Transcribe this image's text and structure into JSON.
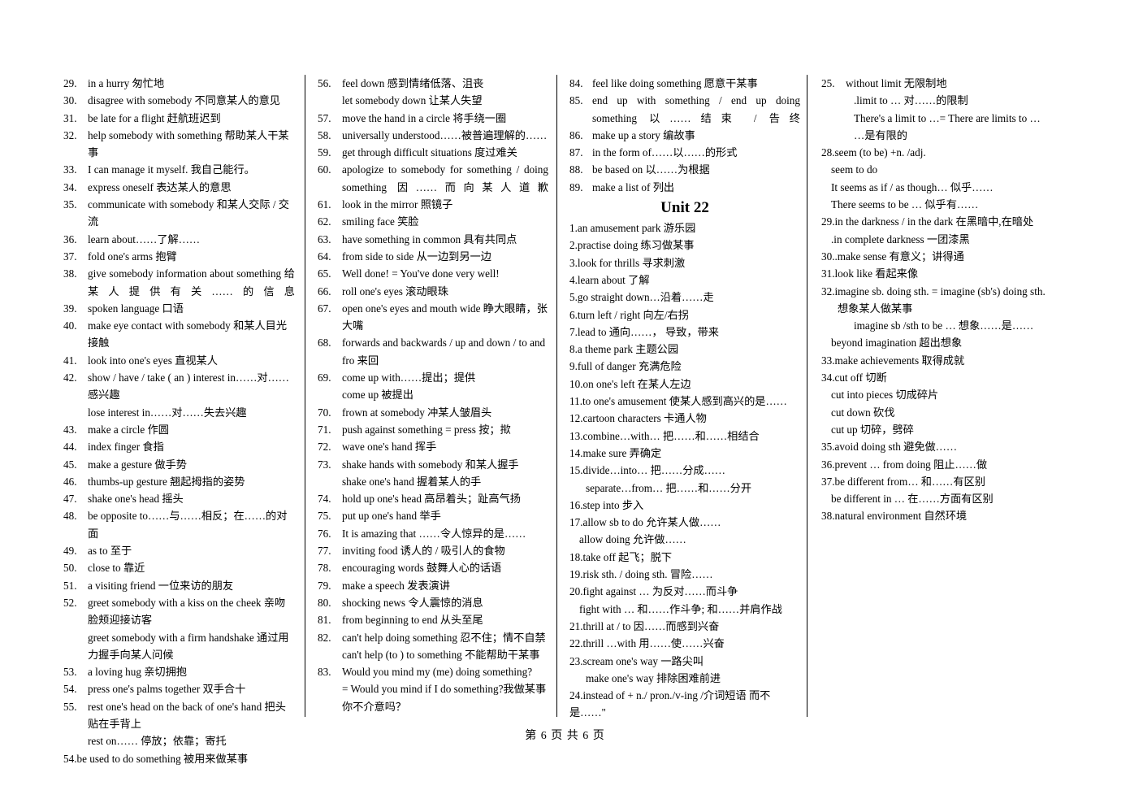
{
  "document": {
    "footer": "第 6 页 共 6 页",
    "unit_heading": "Unit 22"
  },
  "columns": [
    {
      "id": "column-1",
      "entries": [
        {
          "num": "29.",
          "text": "in a hurry  匆忙地"
        },
        {
          "num": "30.",
          "text": "disagree with somebody  不同意某人的意见"
        },
        {
          "num": "31.",
          "text": "be late for a flight  赶航班迟到"
        },
        {
          "num": "32.",
          "text": "help somebody with something  帮助某人干某事"
        },
        {
          "num": "33.",
          "text": "I can manage it myself. 我自己能行。"
        },
        {
          "num": "34.",
          "text": "express oneself  表达某人的意思"
        },
        {
          "num": "35.",
          "text": "communicate with somebody  和某人交际 / 交流"
        },
        {
          "num": "36.",
          "text": "learn about……了解……"
        },
        {
          "num": "37.",
          "text": "fold one's arms  抱臂"
        },
        {
          "num": "38.",
          "text": "give somebody information about something  给某人提供有关……的信息"
        },
        {
          "num": "39.",
          "text": "spoken language  口语"
        },
        {
          "num": "40.",
          "text": "make eye contact with somebody  和某人目光接触"
        },
        {
          "num": "41.",
          "text": "look into one's eyes  直视某人"
        },
        {
          "num": "42.",
          "text": "show / have / take ( an ) interest in……对……感兴趣"
        },
        {
          "num": "",
          "text": "lose interest in……对……失去兴趣",
          "sub": true
        },
        {
          "num": "43.",
          "text": "make a circle  作圆"
        },
        {
          "num": "44.",
          "text": "index finger  食指"
        },
        {
          "num": "45.",
          "text": "make a gesture  做手势"
        },
        {
          "num": "46.",
          "text": "thumbs-up gesture  翘起拇指的姿势"
        },
        {
          "num": "47.",
          "text": "shake one's head  摇头"
        },
        {
          "num": "48.",
          "text": "be opposite to……与……相反；在……的对面"
        },
        {
          "num": "49.",
          "text": "as to  至于"
        },
        {
          "num": "50.",
          "text": "close to  靠近"
        },
        {
          "num": "51.",
          "text": "a visiting friend  一位来访的朋友"
        },
        {
          "num": "52.",
          "text": "greet somebody with a kiss on the cheek  亲吻脸颊迎接访客"
        },
        {
          "num": "",
          "text": "greet somebody with a firm handshake  通过用力握手向某人问候",
          "sub": true
        },
        {
          "num": "53.",
          "text": "a loving hug  亲切拥抱"
        },
        {
          "num": "54.",
          "text": "press one's palms together  双手合十"
        },
        {
          "num": "55.",
          "text": "rest one's head on the back of one's hand  把头贴在手背上"
        },
        {
          "num": "",
          "text": "rest on……  停放；依靠；寄托",
          "sub": true
        },
        {
          "num": "54.",
          "text": "be used to do something  被用来做某事"
        }
      ]
    },
    {
      "id": "column-2",
      "entries": [
        {
          "num": "56.",
          "text": "feel down  感到情绪低落、沮丧"
        },
        {
          "num": "",
          "text": "let somebody down  让某人失望",
          "sub": true
        },
        {
          "num": "57.",
          "text": "move the hand in a circle  将手绕一圈"
        },
        {
          "num": "58.",
          "text": "universally understood……被普遍理解的……"
        },
        {
          "num": "59.",
          "text": "get through difficult situations  度过难关"
        },
        {
          "num": "60.",
          "text": "apologize to somebody for something / doing something  因……而向某人道歉"
        },
        {
          "num": "61.",
          "text": "look in the mirror  照镜子"
        },
        {
          "num": "62.",
          "text": "smiling face  笑脸"
        },
        {
          "num": "63.",
          "text": "have something in common  具有共同点"
        },
        {
          "num": "64.",
          "text": "from side to side  从一边到另一边"
        },
        {
          "num": "65.",
          "text": "Well done! = You've done very well!"
        },
        {
          "num": "66.",
          "text": "roll one's eyes  滚动眼珠"
        },
        {
          "num": "67.",
          "text": "open one's eyes and mouth wide  睁大眼睛，张大嘴"
        },
        {
          "num": "68.",
          "text": "forwards and backwards / up and down / to and fro  来回"
        },
        {
          "num": "69.",
          "text": "come up with……提出；提供"
        },
        {
          "num": "",
          "text": "come up  被提出",
          "sub": true
        },
        {
          "num": "70.",
          "text": "frown at somebody  冲某人皱眉头"
        },
        {
          "num": "71.",
          "text": "push against something = press  按；揿"
        },
        {
          "num": "72.",
          "text": "wave one's hand  挥手"
        },
        {
          "num": "73.",
          "text": "shake hands with somebody  和某人握手"
        },
        {
          "num": "",
          "text": "shake one's hand  握着某人的手",
          "sub": true
        },
        {
          "num": "74.",
          "text": "hold up one's head  高昂着头；趾高气扬"
        },
        {
          "num": "75.",
          "text": "put up one's hand  举手"
        },
        {
          "num": "76.",
          "text": "It is amazing that ……令人惊异的是……"
        },
        {
          "num": "77.",
          "text": "inviting food  诱人的 / 吸引人的食物"
        },
        {
          "num": "78.",
          "text": "encouraging words  鼓舞人心的话语"
        },
        {
          "num": "79.",
          "text": "make a speech  发表演讲"
        },
        {
          "num": "80.",
          "text": "shocking news  令人震惊的消息"
        },
        {
          "num": "81.",
          "text": "from beginning to end  从头至尾"
        },
        {
          "num": "82.",
          "text": "can't help doing something  忍不住；情不自禁"
        },
        {
          "num": "",
          "text": "can't help (to ) to something  不能帮助干某事",
          "sub": true
        },
        {
          "num": "83.",
          "text": "Would you mind my (me) doing something?"
        },
        {
          "num": "",
          "text": "= Would you mind if I do something?我做某事你不介意吗？",
          "sub": true
        }
      ]
    },
    {
      "id": "column-3",
      "entries": [
        {
          "num": "84.",
          "text": "feel like doing something  愿意干某事"
        },
        {
          "num": "85.",
          "text": "end up with something / end up doing something  以……结束 / 告终"
        },
        {
          "num": "86.",
          "text": "make up a story  编故事"
        },
        {
          "num": "87.",
          "text": "in the form of……以……的形式"
        },
        {
          "num": "88.",
          "text": "be based on  以……为根据"
        },
        {
          "num": "89.",
          "text": "make a list of  列出"
        },
        {
          "num": "1.",
          "text": "an amusement park  游乐园"
        },
        {
          "num": "2.",
          "text": "practise doing  练习做某事"
        },
        {
          "num": "3.",
          "text": "look for thrills  寻求刺激"
        },
        {
          "num": "4.",
          "text": "learn about  了解"
        },
        {
          "num": "5.",
          "text": "go straight down…沿着……走"
        },
        {
          "num": "6.",
          "text": "turn left / right   向左/右拐"
        },
        {
          "num": "7.",
          "text": "lead to  通向……，  导致，带来"
        },
        {
          "num": "8.",
          "text": "a theme park  主题公园"
        },
        {
          "num": "9.",
          "text": "full of danger  充满危险"
        },
        {
          "num": "10.",
          "text": "on one's left  在某人左边"
        },
        {
          "num": "11.",
          "text": "to one's amusement  使某人感到高兴的是……"
        },
        {
          "num": "12.",
          "text": "cartoon characters  卡通人物"
        },
        {
          "num": "13.",
          "text": "combine…with…   把……和……相结合"
        },
        {
          "num": "14.",
          "text": "make sure  弄确定"
        },
        {
          "num": "15.",
          "text": "divide…into…  把……分成……"
        },
        {
          "num": "",
          "text": "separate…from…  把……和……分开",
          "sub": true
        },
        {
          "num": "16.",
          "text": "step into  步入"
        },
        {
          "num": "17.",
          "text": "allow sb to do  允许某人做……"
        },
        {
          "num": "",
          "text": "allow doing      允许做……",
          "sub": true
        },
        {
          "num": "18.",
          "text": "take off   起飞；脱下"
        },
        {
          "num": "19.",
          "text": "risk sth. / doing sth.  冒险……"
        },
        {
          "num": "20.",
          "text": "fight against …  为反对……而斗争"
        },
        {
          "num": "",
          "text": "fight with … 和……作斗争; 和……并肩作战",
          "sub": true
        },
        {
          "num": "21.",
          "text": "thrill at / to   因……而感到兴奋"
        },
        {
          "num": "22.",
          "text": "thrill …with 用……使……兴奋"
        },
        {
          "num": "23.",
          "text": "scream one's way  一路尖叫"
        },
        {
          "num": "",
          "text": "make one's way  排除困难前进",
          "sub": true
        },
        {
          "num": "24.",
          "text": "instead of + n./ pron./v-ing  /介词短语   而不是……\""
        }
      ]
    },
    {
      "id": "column-4",
      "entries": [
        {
          "num": "25.",
          "text": "without limit  无限制地"
        },
        {
          "num": "",
          "text": ".limit to …      对……的限制",
          "sub": true
        },
        {
          "num": "",
          "text": "There's a limit to …= There are limits to …",
          "sub": true
        },
        {
          "num": "",
          "text": "…是有限的",
          "sub": true
        },
        {
          "num": "28.",
          "text": "seem (to be) +n. /adj."
        },
        {
          "num": "",
          "text": "seem to do",
          "sub": true
        },
        {
          "num": "",
          "text": "It seems as if / as though…       似乎……",
          "sub": true
        },
        {
          "num": "",
          "text": "There seems to be …       似乎有……",
          "sub": true
        },
        {
          "num": "29.",
          "text": "in the darkness / in the dark   在黑暗中,在暗处"
        },
        {
          "num": "",
          "text": ".in complete darkness  一团漆黑",
          "sub": true
        },
        {
          "num": "30.",
          "text": ".make sense  有意义；讲得通"
        },
        {
          "num": "31.",
          "text": "look like  看起来像"
        },
        {
          "num": "32.",
          "text": "imagine sb. doing sth.   = imagine (sb's) doing sth."
        },
        {
          "num": "",
          "text": "想象某人做某事",
          "sub": true
        },
        {
          "num": "",
          "text": "imagine sb /sth to be …    想象……是……",
          "sub": true
        },
        {
          "num": "",
          "text": "beyond imagination  超出想象",
          "sub": true
        },
        {
          "num": "33.",
          "text": "make achievements  取得成就"
        },
        {
          "num": "34.",
          "text": "cut off  切断"
        },
        {
          "num": "",
          "text": "cut into pieces  切成碎片",
          "sub": true
        },
        {
          "num": "",
          "text": "cut down  砍伐",
          "sub": true
        },
        {
          "num": "",
          "text": "cut up  切碎，劈碎",
          "sub": true
        },
        {
          "num": "35.",
          "text": "avoid doing sth   避免做……"
        },
        {
          "num": "36.",
          "text": "prevent … from doing  阻止……做"
        },
        {
          "num": "37.",
          "text": "be different from…      和……有区别"
        },
        {
          "num": "",
          "text": "be different in …     在……方面有区别",
          "sub": true
        },
        {
          "num": "38.",
          "text": "natural environment  自然环境"
        }
      ]
    }
  ]
}
